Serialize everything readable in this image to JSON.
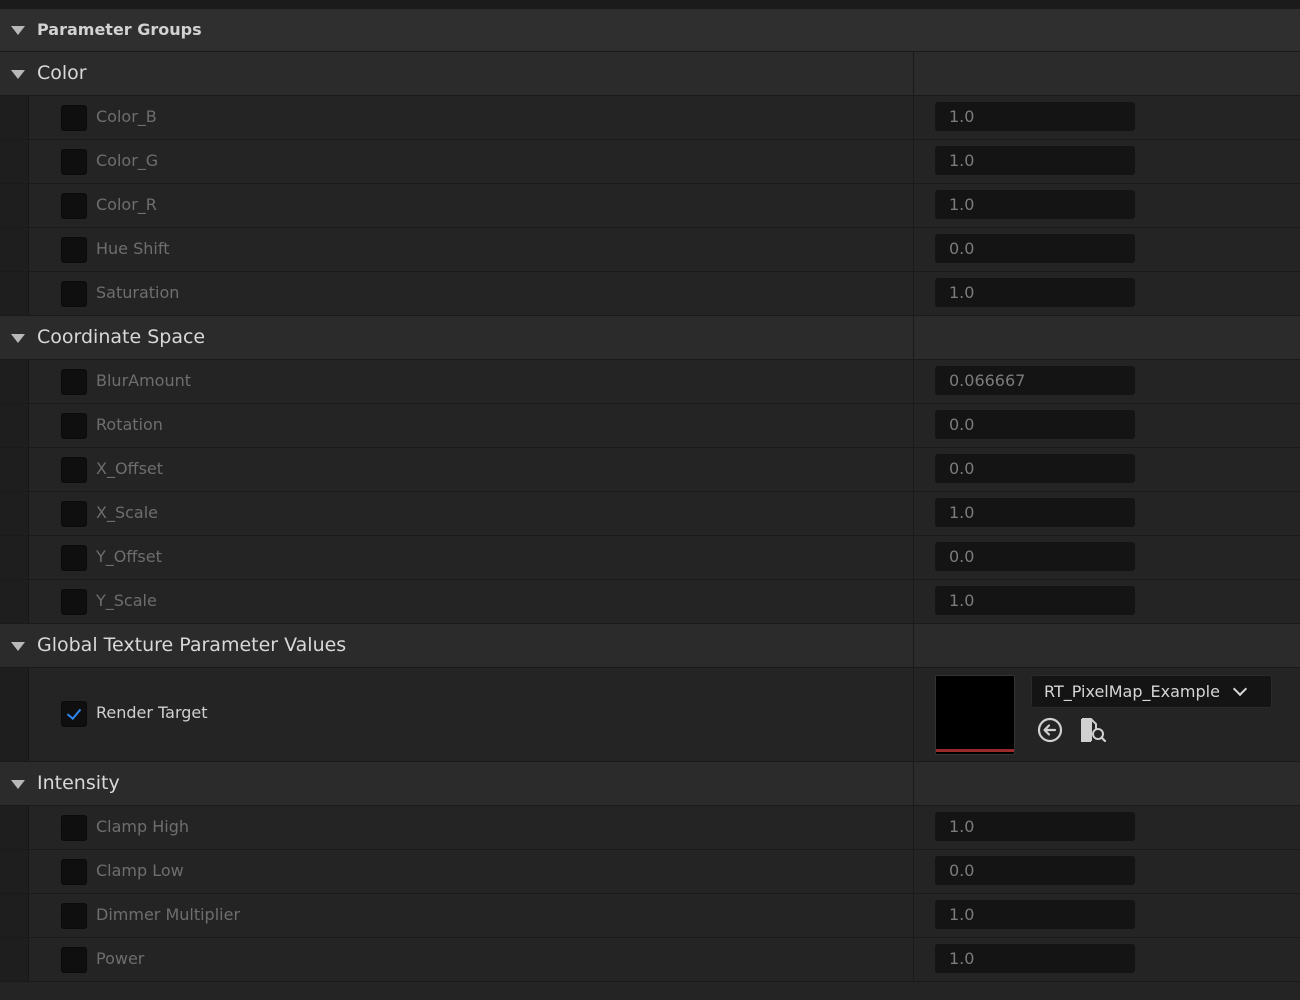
{
  "header": {
    "title": "Parameter Groups"
  },
  "groups": [
    {
      "title": "Color",
      "params": [
        {
          "label": "Color_B",
          "value": "1.0",
          "checked": false
        },
        {
          "label": "Color_G",
          "value": "1.0",
          "checked": false
        },
        {
          "label": "Color_R",
          "value": "1.0",
          "checked": false
        },
        {
          "label": "Hue Shift",
          "value": "0.0",
          "checked": false
        },
        {
          "label": "Saturation",
          "value": "1.0",
          "checked": false
        }
      ]
    },
    {
      "title": "Coordinate Space",
      "params": [
        {
          "label": "BlurAmount",
          "value": "0.066667",
          "checked": false
        },
        {
          "label": "Rotation",
          "value": "0.0",
          "checked": false
        },
        {
          "label": "X_Offset",
          "value": "0.0",
          "checked": false
        },
        {
          "label": "X_Scale",
          "value": "1.0",
          "checked": false
        },
        {
          "label": "Y_Offset",
          "value": "0.0",
          "checked": false
        },
        {
          "label": "Y_Scale",
          "value": "1.0",
          "checked": false
        }
      ]
    },
    {
      "title": "Global Texture Parameter Values",
      "texture": {
        "label": "Render Target",
        "checked": true,
        "asset": "RT_PixelMap_Example",
        "icons": [
          "use-selected-asset-icon",
          "browse-asset-icon"
        ]
      }
    },
    {
      "title": "Intensity",
      "params": [
        {
          "label": "Clamp High",
          "value": "1.0",
          "checked": false
        },
        {
          "label": "Clamp Low",
          "value": "0.0",
          "checked": false
        },
        {
          "label": "Dimmer Multiplier",
          "value": "1.0",
          "checked": false
        },
        {
          "label": "Power",
          "value": "1.0",
          "checked": false
        }
      ]
    }
  ],
  "colors": {
    "background": "#242424",
    "check_accent": "#2e86f0",
    "thumbnail_bar": "#9b2b2b"
  }
}
